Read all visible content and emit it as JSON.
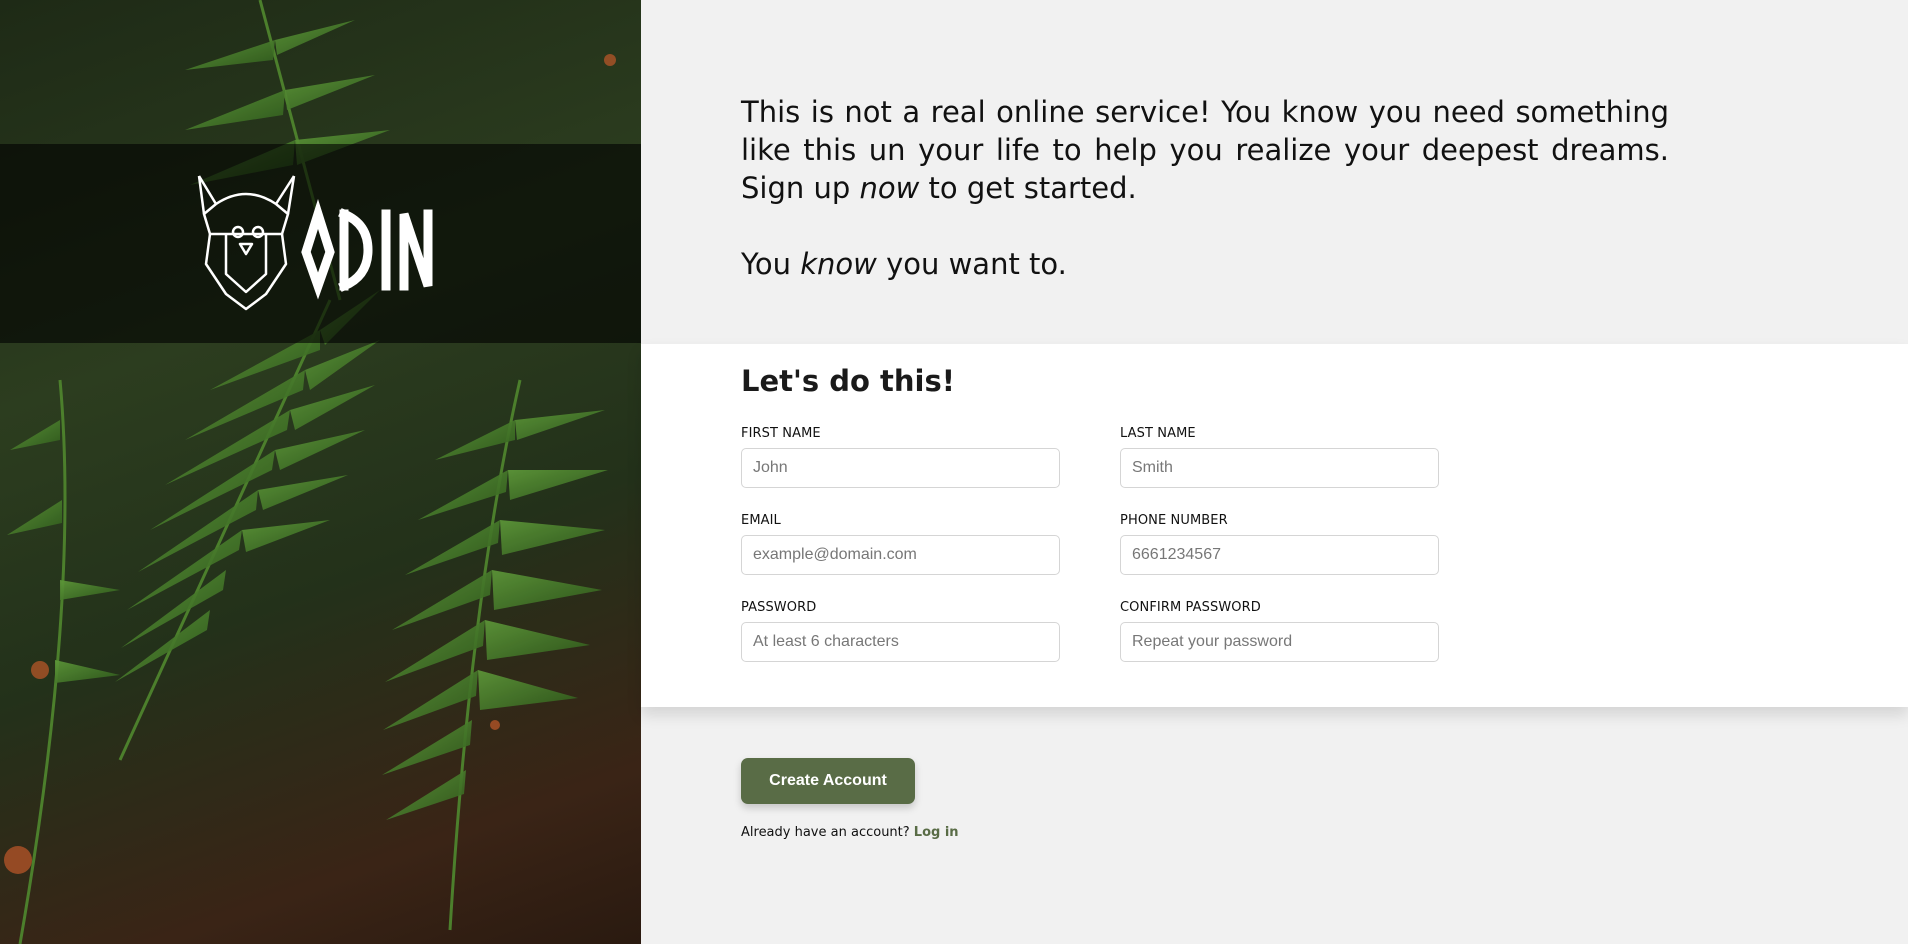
{
  "brand": {
    "name": "ODIN"
  },
  "intro": {
    "line1_a": "This is not a real online service! You know you need something like this un your life to help you realize your deepest dreams. Sign up ",
    "line1_em": "now",
    "line1_b": " to get started.",
    "line2_a": "You ",
    "line2_em": "know",
    "line2_b": " you want to."
  },
  "form": {
    "title": "Let's do this!",
    "first_name": {
      "label": "FIRST NAME",
      "placeholder": "John",
      "value": ""
    },
    "last_name": {
      "label": "LAST NAME",
      "placeholder": "Smith",
      "value": ""
    },
    "email": {
      "label": "EMAIL",
      "placeholder": "example@domain.com",
      "value": ""
    },
    "phone": {
      "label": "PHONE NUMBER",
      "placeholder": "6661234567",
      "value": ""
    },
    "password": {
      "label": "PASSWORD",
      "placeholder": "At least 6 characters",
      "value": ""
    },
    "confirm_password": {
      "label": "CONFIRM PASSWORD",
      "placeholder": "Repeat your password",
      "value": ""
    }
  },
  "actions": {
    "create_label": "Create Account",
    "login_prompt": "Already have an account? ",
    "login_link": "Log in"
  },
  "colors": {
    "accent": "#596c46",
    "background": "#f1f1f1",
    "panel": "#ffffff"
  }
}
